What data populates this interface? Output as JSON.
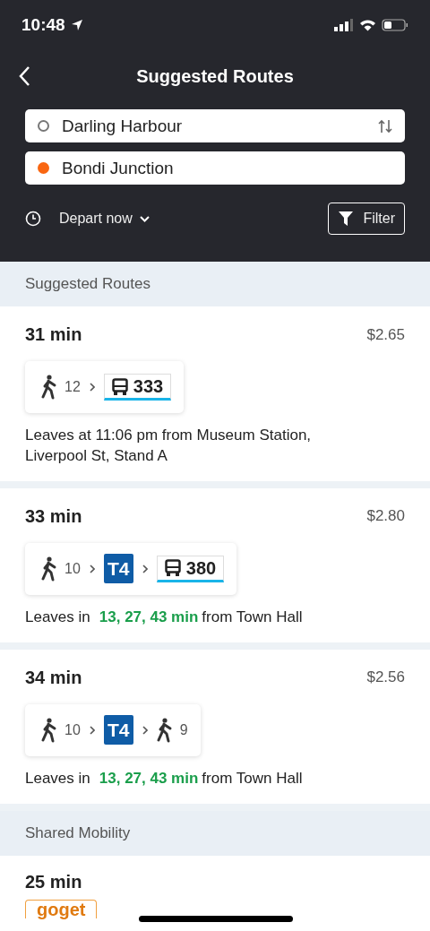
{
  "status_bar": {
    "time": "10:48"
  },
  "header": {
    "title": "Suggested Routes"
  },
  "origin": {
    "value": "Darling Harbour"
  },
  "destination": {
    "value": "Bondi Junction"
  },
  "depart": {
    "label": "Depart now"
  },
  "filter_button": {
    "label": "Filter"
  },
  "sections": [
    {
      "title": "Suggested Routes",
      "routes": [
        {
          "duration": "31 min",
          "fare": "$2.65",
          "legs": [
            {
              "kind": "walk",
              "label": "12"
            },
            {
              "kind": "bus",
              "label": "333"
            }
          ],
          "departure": {
            "prefix": "Leaves at 11:06 pm from Museum Station, Liverpool St, Stand A"
          }
        },
        {
          "duration": "33 min",
          "fare": "$2.80",
          "legs": [
            {
              "kind": "walk",
              "label": "10"
            },
            {
              "kind": "train",
              "label": "T4"
            },
            {
              "kind": "bus",
              "label": "380"
            }
          ],
          "departure": {
            "prefix": "Leaves in",
            "times": "13, 27, 43 min",
            "suffix": "from Town Hall"
          }
        },
        {
          "duration": "34 min",
          "fare": "$2.56",
          "legs": [
            {
              "kind": "walk",
              "label": "10"
            },
            {
              "kind": "train",
              "label": "T4"
            },
            {
              "kind": "walk",
              "label": "9"
            }
          ],
          "departure": {
            "prefix": "Leaves in",
            "times": "13, 27, 43 min",
            "suffix": "from Town Hall"
          }
        }
      ]
    },
    {
      "title": "Shared Mobility",
      "routes": [
        {
          "duration": "25 min",
          "logo": "goget"
        }
      ]
    }
  ]
}
